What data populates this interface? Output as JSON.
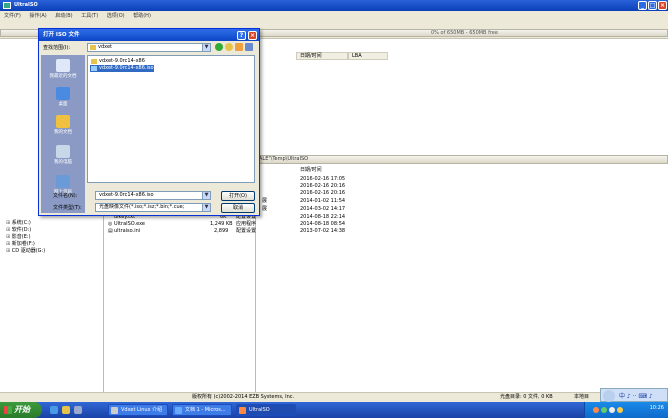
{
  "window": {
    "title": "UltraISO"
  },
  "menu": [
    "文件(F)",
    "操作(A)",
    "启动(B)",
    "工具(T)",
    "选项(O)",
    "帮助(H)"
  ],
  "image_info": "0% of 650MB - 650MB free",
  "upper_pane": {
    "columns": [
      "日期/时间",
      "LBA"
    ]
  },
  "path_bar": "ALE\"\\Temp\\UltraISO",
  "lower_pane": {
    "columns": [
      "日期/时间"
    ],
    "dates": [
      "2016-02-16 17:05",
      "2016-02-16 20:16",
      "2016-02-16 20:16",
      "2014-01-02 11:54",
      "2014-03-02 14:17",
      "2014-08-18 22:14",
      "2014-08-18 08:54",
      "2013-07-02 14:38"
    ],
    "partial_types": [
      "展",
      "展"
    ],
    "files": [
      {
        "name": "uikey.txt",
        "size": "6K",
        "type": "配置设置"
      },
      {
        "name": "UltraISO.exe",
        "size": "1,249 KB",
        "type": "应用程序"
      },
      {
        "name": "ultraiso.ini",
        "size": "2,899",
        "type": "配置设置"
      }
    ]
  },
  "tree": [
    "系统(C:)",
    "软件(D:)",
    "影音(E:)",
    "新加卷(F:)",
    "CD 驱动器(G:)"
  ],
  "statusbar": {
    "copyright": "版权所有 (c)2002-2014 EZB Systems, Inc.",
    "image_total": "光盘目录: 0 文件, 0 KB",
    "local": "本地目"
  },
  "language_bar": "中 ♪ ·· ⌨ ♪",
  "dialog": {
    "title": "打开 ISO 文件",
    "lookin_label": "查找范围(I):",
    "lookin_value": "vdxet",
    "places": [
      "我最近的文档",
      "桌面",
      "我的文档",
      "我的电脑",
      "网上邻居"
    ],
    "files": [
      {
        "name": "vdxet-9.0rc14-x86",
        "selected": false
      },
      {
        "name": "vdxet-9.0rc14-x86.iso",
        "selected": true
      }
    ],
    "filename_label": "文件名(N):",
    "filename_value": "vdxet-9.0rc14-x86.iso",
    "filetype_label": "文件类型(T):",
    "filetype_value": "光盘映像文件(*.iso;*.isz;*.bin;*.cue;",
    "open_button": "打开(O)",
    "cancel_button": "取消"
  },
  "taskbar": {
    "start": "开始",
    "tasks": [
      "Vdxet Linux 介绍",
      "文档 1 - Micros...",
      "UltraISO"
    ],
    "clock": "10:26"
  },
  "colors": {
    "title_blue": "#0b45c6",
    "selection": "#316ac5",
    "start_green": "#2a7a2a",
    "places_bar": "#8a9ac4"
  }
}
